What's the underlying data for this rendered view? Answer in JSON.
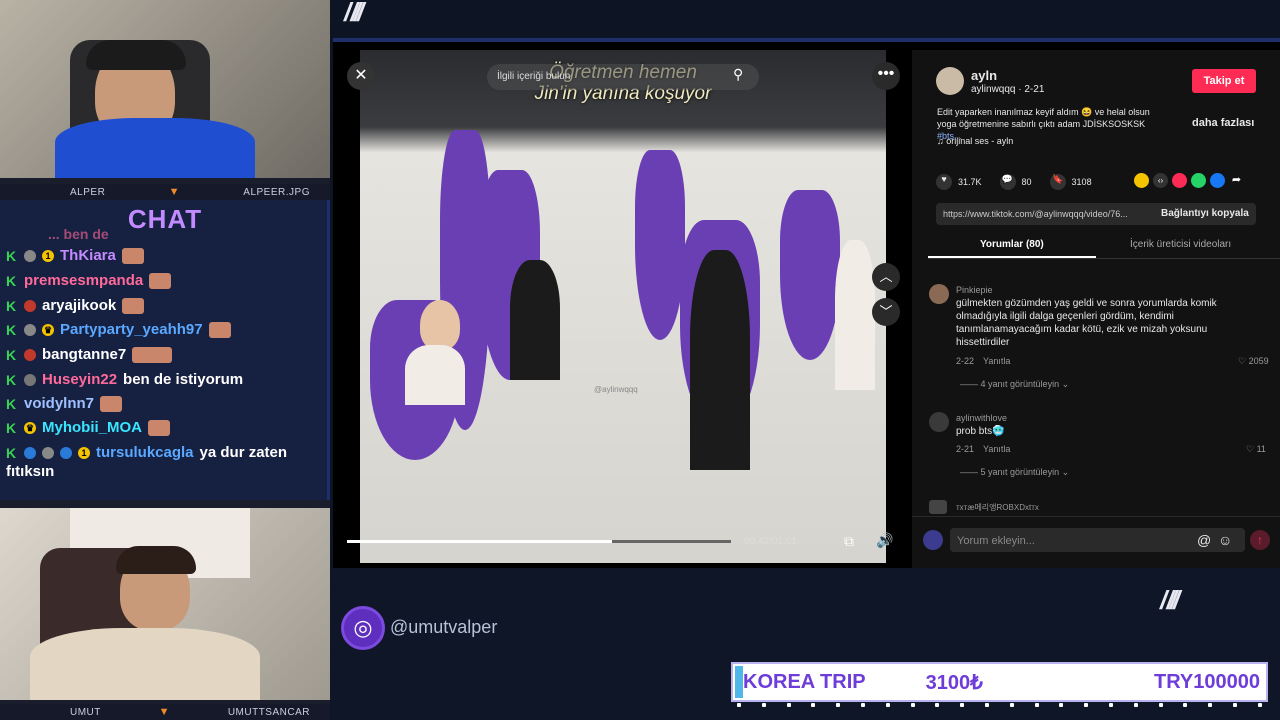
{
  "cams": {
    "top": {
      "left_name": "ALPER",
      "right_name": "ALPEER.JPG"
    },
    "bottom": {
      "left_name": "UMUT",
      "right_name": "UMUTTSANCAR"
    }
  },
  "chat": {
    "title": "CHAT",
    "partial_top": "... ben de",
    "messages": [
      {
        "user": "ThKiara",
        "text": "",
        "color": "#c38bff"
      },
      {
        "user": "premsesmpanda",
        "text": "",
        "color": "#ff6a9a"
      },
      {
        "user": "aryajikook",
        "text": "",
        "color": "#ffffff"
      },
      {
        "user": "Partyparty_yeahh97",
        "text": "",
        "color": "#5aa8ff"
      },
      {
        "user": "bangtanne7",
        "text": "",
        "color": "#ffffff"
      },
      {
        "user": "Huseyin22",
        "text": "ben de istiyorum",
        "color": "#ff6a9a"
      },
      {
        "user": "voidylnn7",
        "text": "",
        "color": "#9fc0ff"
      },
      {
        "user": "Myhobii_MOA",
        "text": "",
        "color": "#39e6ff"
      },
      {
        "user": "tursulukcagla",
        "text": "ya dur zaten",
        "color": "#5aa8ff"
      }
    ],
    "wrap_line": "fıtıksın"
  },
  "video": {
    "search_placeholder": "İlgili içeriği bulun",
    "caption_line1": "Öğretmen hemen",
    "caption_line2": "Jin'in yanına koşuyor",
    "time": "00:42/01:01",
    "progress": 0.69,
    "watermark": "@aylinwqqq"
  },
  "panel": {
    "display_name": "ayln",
    "username_date": "aylinwqqq · 2-21",
    "follow_label": "Takip et",
    "description": "Edit yaparken inanılmaz keyif aldım 😆 ve helal olsun yoga öğretmenine sabırlı çıktı adam JDİSKSOSKSK",
    "hashtag": "#bts...",
    "more_label": "daha fazlası",
    "sound": "♫ orijinal ses - ayln",
    "likes": "31.7K",
    "comments_count": "80",
    "saves": "3108",
    "link": "https://www.tiktok.com/@aylinwqqq/video/76...",
    "copy_link": "Bağlantıyı kopyala",
    "tab_comments": "Yorumlar (80)",
    "tab_creator": "İçerik üreticisi videoları",
    "comments": [
      {
        "user": "Pinkiepie",
        "text": "gülmekten gözümden yaş geldi ve sonra yorumlarda komik olmadığıyla ilgili dalga geçenleri gördüm, kendimi tanımlanamayacağım kadar kötü, ezik ve mizah yoksunu hissettirdiler",
        "date": "2-22",
        "reply": "Yanıtla",
        "likes": "2059",
        "view_replies": "4 yanıt görüntüleyin"
      },
      {
        "user": "aylinwithlove",
        "text": "prob bts🥶",
        "date": "2-21",
        "reply": "Yanıtla",
        "likes": "11",
        "view_replies": "5 yanıt görüntüleyin"
      }
    ],
    "partial_comment_user": "тxтæ메리앵ROBXDxtтx",
    "comment_placeholder": "Yorum ekleyin..."
  },
  "overlay": {
    "slashes_top": "/ ///",
    "slashes_right": "/ ///",
    "handle": "@umutvalper"
  },
  "goal": {
    "name": "KOREA TRIP",
    "current": "3100₺",
    "target": "TRY100000",
    "progress": 0.031
  },
  "colors": {
    "accent_purple": "#6e3cd8",
    "tiktok_red": "#fe2c55",
    "frame_blue": "#1e2f6c",
    "kick_green": "#39d353"
  }
}
